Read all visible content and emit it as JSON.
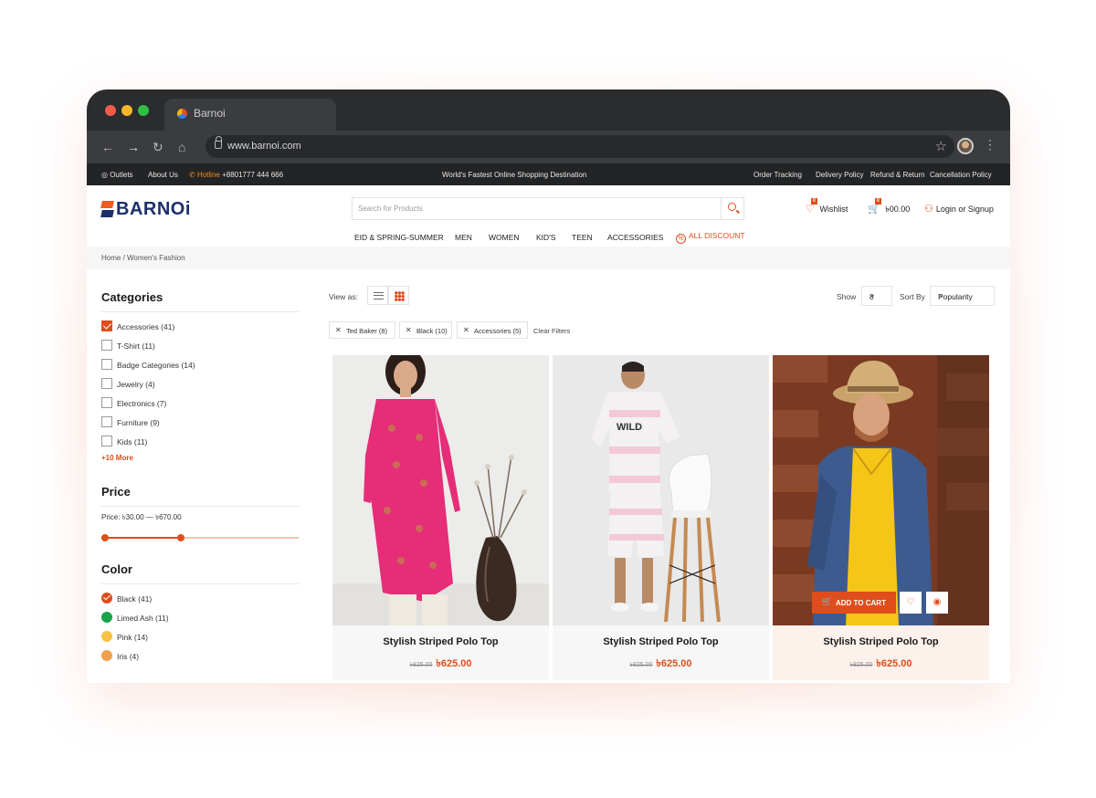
{
  "browser": {
    "tab_title": "Barnoi",
    "url": "www.barnoi.com"
  },
  "topbar": {
    "outlets": "Outlets",
    "about": "About Us",
    "hotline_label": "Hotline",
    "hotline_number": "+8801777 444 666",
    "tagline": "World's Fastest Online Shopping Destination",
    "links": [
      "Order Tracking",
      "Delivery Policy",
      "Refund & Return",
      "Cancellation Policy"
    ]
  },
  "header": {
    "logo": "BARNOi",
    "search_placeholder": "Search for Products",
    "wishlist_label": "Wishlist",
    "wishlist_count": "0",
    "cart_total": "৳00.00",
    "cart_count": "0",
    "login": "Login or Signup"
  },
  "menu": [
    "EID & SPRING-SUMMER",
    "MEN",
    "WOMEN",
    "KID'S",
    "TEEN",
    "ACCESSORIES"
  ],
  "menu_discount": "ALL DISCOUNT",
  "breadcrumb": "Home / Women's Fashion",
  "sidebar": {
    "categories_title": "Categories",
    "categories": [
      {
        "label": "Accessories  (41)",
        "checked": true
      },
      {
        "label": "T-Shirt  (11)",
        "checked": false
      },
      {
        "label": "Badge Categories  (14)",
        "checked": false
      },
      {
        "label": "Jewelry  (4)",
        "checked": false
      },
      {
        "label": "Electronics  (7)",
        "checked": false
      },
      {
        "label": "Furniture  (9)",
        "checked": false
      },
      {
        "label": "Kids  (11)",
        "checked": false
      }
    ],
    "more": "+10 More",
    "price_title": "Price",
    "price_range": "Price: ৳30.00 — ৳670.00",
    "price_slider": {
      "min_fraction": 0.0,
      "max_fraction": 0.4
    },
    "color_title": "Color",
    "colors": [
      {
        "label": "Black  (41)",
        "color": "#e04d1c",
        "checked": true
      },
      {
        "label": "Limed Ash  (11)",
        "color": "#1aa34a",
        "checked": false
      },
      {
        "label": "Pink  (14)",
        "color": "#f7c243",
        "checked": false
      },
      {
        "label": "Iris  (4)",
        "color": "#f0a04b",
        "checked": false
      }
    ]
  },
  "toolbar": {
    "view_as": "View as:",
    "show_label": "Show",
    "show_value": "8",
    "sort_label": "Sort By",
    "sort_value": "Popularity"
  },
  "filters": {
    "chips": [
      "Ted Baker (8)",
      "Black (10)",
      "Accessories (5)"
    ],
    "clear": "Clear Filters"
  },
  "products": [
    {
      "name": "Stylish Striped Polo Top",
      "old_price": "৳825.00",
      "price": "৳625.00"
    },
    {
      "name": "Stylish Striped Polo Top",
      "old_price": "৳825.00",
      "price": "৳625.00"
    },
    {
      "name": "Stylish Striped Polo Top",
      "old_price": "৳825.00",
      "price": "৳625.00"
    }
  ],
  "add_to_cart": "ADD TO CART",
  "accent_color": "#e04d1c",
  "brand_color": "#1c2f6b"
}
